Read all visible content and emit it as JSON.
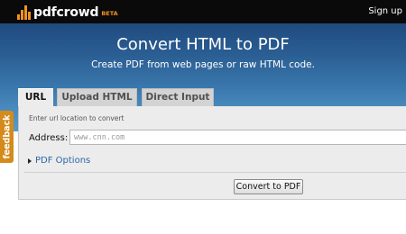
{
  "header": {
    "logo_text": "pdfcrowd",
    "beta_label": "BETA",
    "signup_label": "Sign up"
  },
  "hero": {
    "title": "Convert HTML to PDF",
    "subtitle": "Create PDF from web pages or raw HTML code."
  },
  "tabs": [
    {
      "label": "URL",
      "active": true
    },
    {
      "label": "Upload HTML",
      "active": false
    },
    {
      "label": "Direct Input",
      "active": false
    }
  ],
  "form": {
    "hint": "Enter url location to convert",
    "address_label": "Address:",
    "address_value": "",
    "address_placeholder": "www.cnn.com",
    "options_label": "PDF Options",
    "convert_label": "Convert to PDF"
  },
  "feedback": {
    "label": "feedback"
  },
  "colors": {
    "brand_orange": "#f09223",
    "header_bg": "#0a0a0a",
    "hero_gradient_top": "#1f4a7e",
    "hero_gradient_bottom": "#5a9ac6",
    "link_blue": "#2b66a8",
    "feedback_bg": "#d48b1b"
  }
}
